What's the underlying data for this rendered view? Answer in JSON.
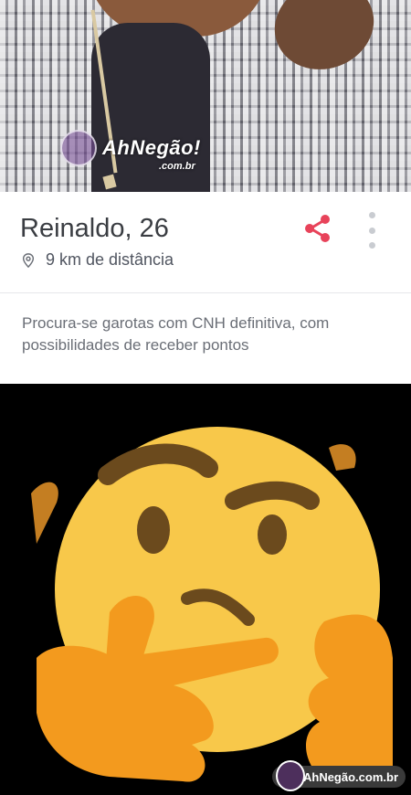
{
  "photo": {
    "watermark": "AhNegão!",
    "watermark_sub": ".com.br"
  },
  "profile": {
    "name_age": "Reinaldo, 26",
    "distance": "9 km de distância",
    "bio": "Procura-se garotas com CNH definitiva, com possibilidades de receber pontos",
    "icons": {
      "location": "map-pin-icon",
      "share": "share-icon",
      "more": "more-vertical-icon"
    },
    "accent": "#e8435a"
  },
  "emoji_panel": {
    "emoji": "thinking-face",
    "watermark": "AhNegão.com.br"
  }
}
